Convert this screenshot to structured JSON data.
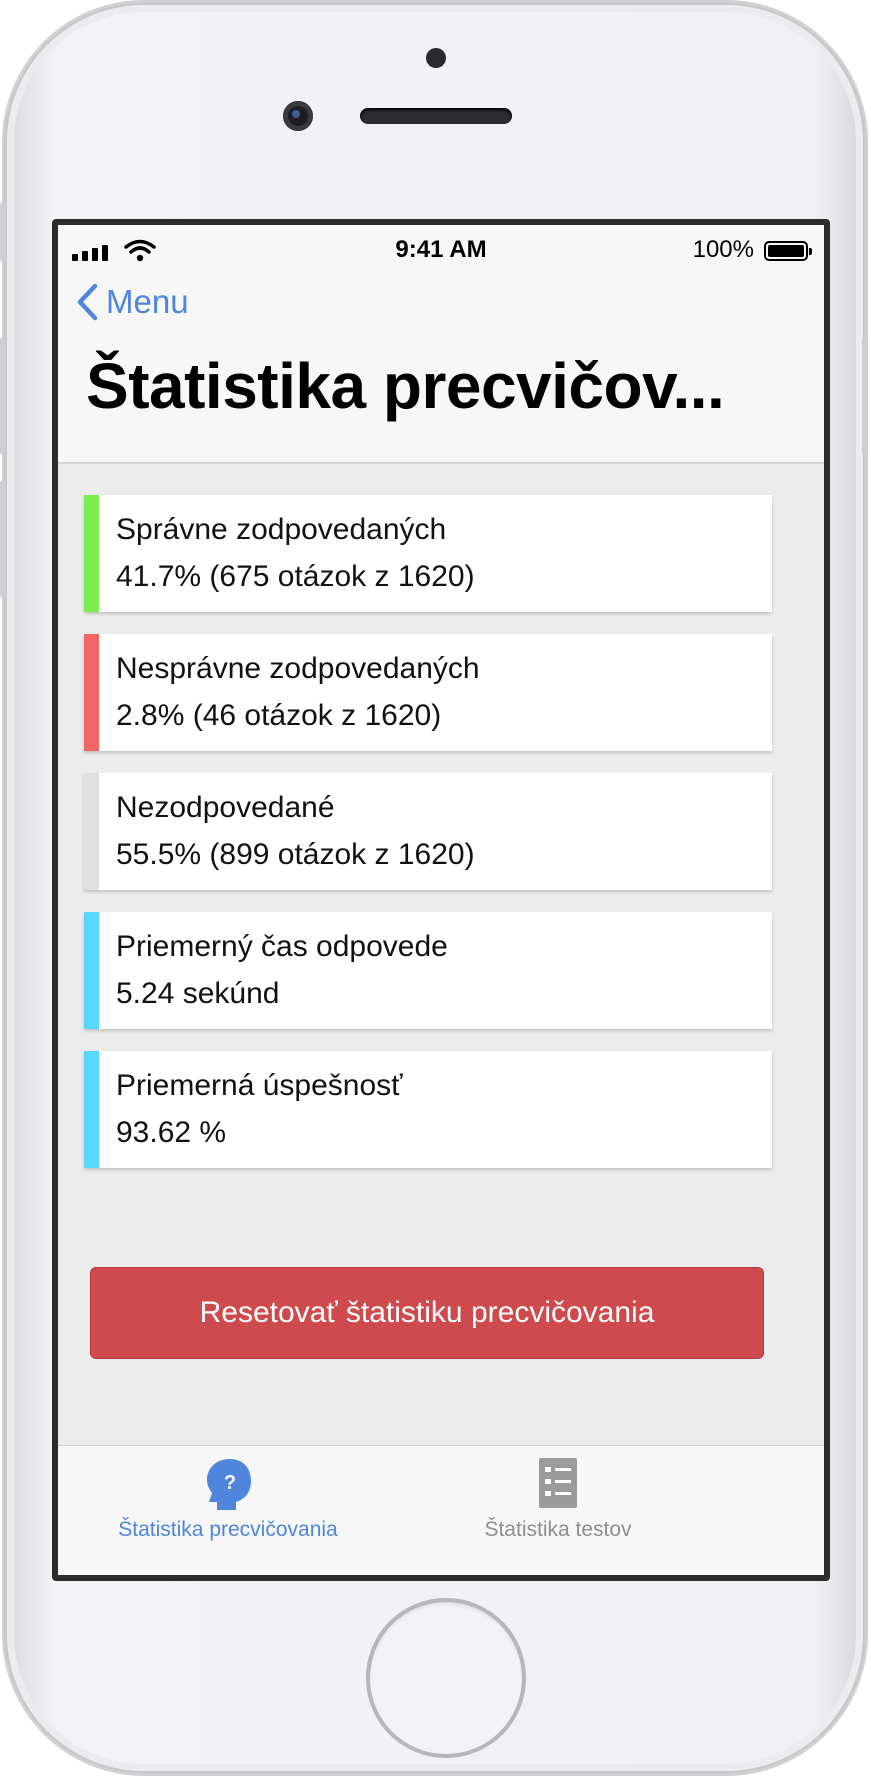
{
  "status_bar": {
    "time": "9:41 AM",
    "battery_percent": "100%",
    "signal_icon": "signal-bars-icon",
    "wifi_icon": "wifi-icon",
    "battery_icon": "battery-full-icon"
  },
  "navbar": {
    "back_label": "Menu",
    "back_icon": "chevron-left-icon",
    "title": "Štatistika precvičov..."
  },
  "stats": [
    {
      "label": "Správne zodpovedaných",
      "value": "41.7% (675 otázok z 1620)",
      "color": "#7ced4f"
    },
    {
      "label": "Nesprávne zodpovedaných",
      "value": "2.8% (46 otázok z 1620)",
      "color": "#f26466"
    },
    {
      "label": "Nezodpovedané",
      "value": "55.5% (899 otázok z 1620)",
      "color": "#e1e1e1"
    },
    {
      "label": "Priemerný čas odpovede",
      "value": "5.24 sekúnd",
      "color": "#56d9fb"
    },
    {
      "label": "Priemerná úspešnosť",
      "value": "93.62 %",
      "color": "#56d9fb"
    }
  ],
  "reset_button": {
    "label": "Resetovať štatistiku precvičovania",
    "color": "#cf4a4e"
  },
  "tabs": [
    {
      "label": "Štatistika precvičovania",
      "icon": "head-question-icon",
      "active": true,
      "color": "#4f86db"
    },
    {
      "label": "Štatistika testov",
      "icon": "checklist-icon",
      "active": false,
      "color": "#8e8e8e"
    }
  ]
}
